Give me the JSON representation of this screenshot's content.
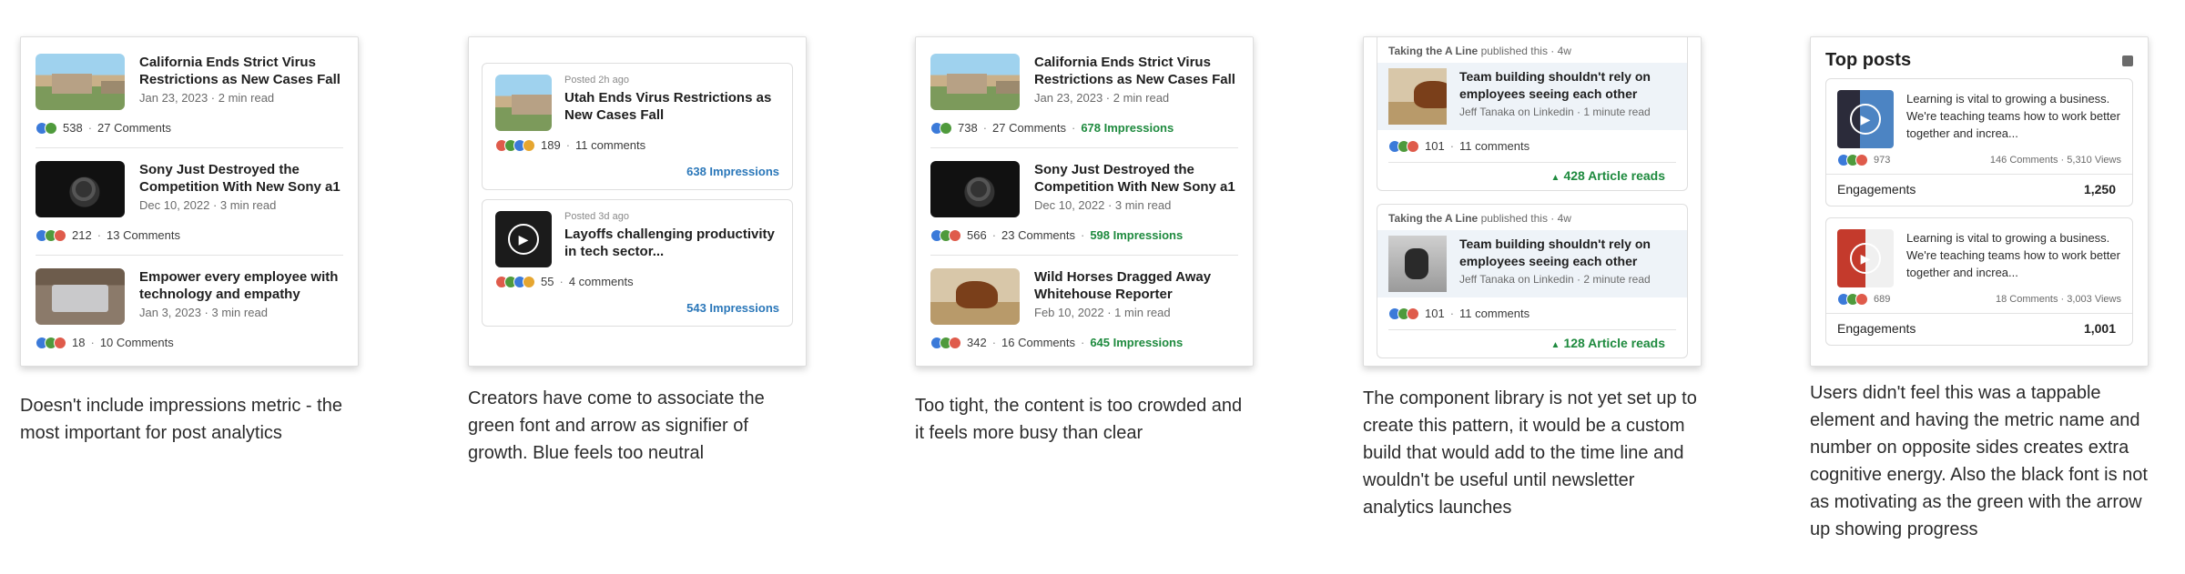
{
  "colors": {
    "green": "#1e8a3e",
    "blue": "#2a77b9",
    "reaction_like": "#3b7ad9",
    "reaction_celebrate": "#4f9a3c",
    "reaction_love": "#df5b4b",
    "reaction_insightful": "#e6a630"
  },
  "option1": {
    "posts": [
      {
        "title": "California Ends Strict Virus Restrictions as New Cases Fall",
        "meta": "Jan 23, 2023 · 2 min read",
        "reactions": "538",
        "comments": "27 Comments",
        "thumb": "city-image"
      },
      {
        "title": "Sony Just Destroyed the Competition With New Sony a1",
        "meta": "Dec 10, 2022 · 3 min read",
        "reactions": "212",
        "comments": "13 Comments",
        "thumb": "camera-image"
      },
      {
        "title": "Empower every employee with technology and empathy",
        "meta": "Jan 3, 2023 · 3 min read",
        "reactions": "18",
        "comments": "10 Comments",
        "thumb": "laptop-image"
      }
    ],
    "caption": "Doesn't include impressions metric - the most important for post analytics"
  },
  "option2": {
    "cards": [
      {
        "posted": "Posted 2h ago",
        "title": "Utah Ends Virus Restrictions as New Cases Fall",
        "reactions": "189",
        "comments": "11 comments",
        "impressions": "638 Impressions"
      },
      {
        "posted": "Posted 3d ago",
        "title": "Layoffs challenging productivity in tech sector...",
        "reactions": "55",
        "comments": "4 comments",
        "impressions": "543 Impressions"
      }
    ],
    "caption": "Creators have come to associate the green font and arrow as signifier of growth. Blue feels too neutral"
  },
  "option3": {
    "posts": [
      {
        "title": "California Ends Strict Virus Restrictions as New Cases Fall",
        "meta": "Jan 23, 2023 · 2 min read",
        "reactions": "738",
        "comments": "27 Comments",
        "impressions": "678 Impressions"
      },
      {
        "title": "Sony Just Destroyed the Competition With New Sony a1",
        "meta": "Dec 10, 2022 · 3 min read",
        "reactions": "566",
        "comments": "23 Comments",
        "impressions": "598 Impressions"
      },
      {
        "title": "Wild Horses Dragged Away Whitehouse Reporter",
        "meta": "Feb 10, 2022 · 1 min read",
        "reactions": "342",
        "comments": "16 Comments",
        "impressions": "645 Impressions"
      }
    ],
    "caption": "Too tight, the content is too crowded and it feels more busy than clear"
  },
  "option4": {
    "cards": [
      {
        "publisher": "Taking the A Line",
        "published": "published this · 4w",
        "title": "Team building shouldn't rely on employees seeing each other",
        "byline": "Jeff Tanaka on Linkedin · 1 minute read",
        "reactions": "101",
        "comments": "11 comments",
        "reads": "428 Article reads"
      },
      {
        "publisher": "Taking the A Line",
        "published": "published this · 4w",
        "title": "Team building shouldn't rely on employees seeing each other",
        "byline": "Jeff Tanaka on Linkedin · 2 minute read",
        "reactions": "101",
        "comments": "11 comments",
        "reads": "128 Article reads"
      }
    ],
    "caption": "The component library is not yet set up to create this pattern, it would be a custom build that would add to the time line and wouldn't be useful until newsletter analytics launches"
  },
  "option5": {
    "title": "Top posts",
    "cards": [
      {
        "text": "Learning is vital to growing a business. We're teaching teams how to work better together and increa...",
        "reactions": "973",
        "stats": "146 Comments · 5,310 Views",
        "metric_label": "Engagements",
        "metric_value": "1,250"
      },
      {
        "text": "Learning is vital to growing a business. We're teaching teams how to work better together and increa...",
        "reactions": "689",
        "stats": "18 Comments · 3,003 Views",
        "metric_label": "Engagements",
        "metric_value": "1,001"
      }
    ],
    "caption": "Users didn't feel this was a tappable element and having the metric name and number on opposite sides creates extra cognitive energy. Also the black font is not as motivating as the green with the arrow up showing progress"
  }
}
